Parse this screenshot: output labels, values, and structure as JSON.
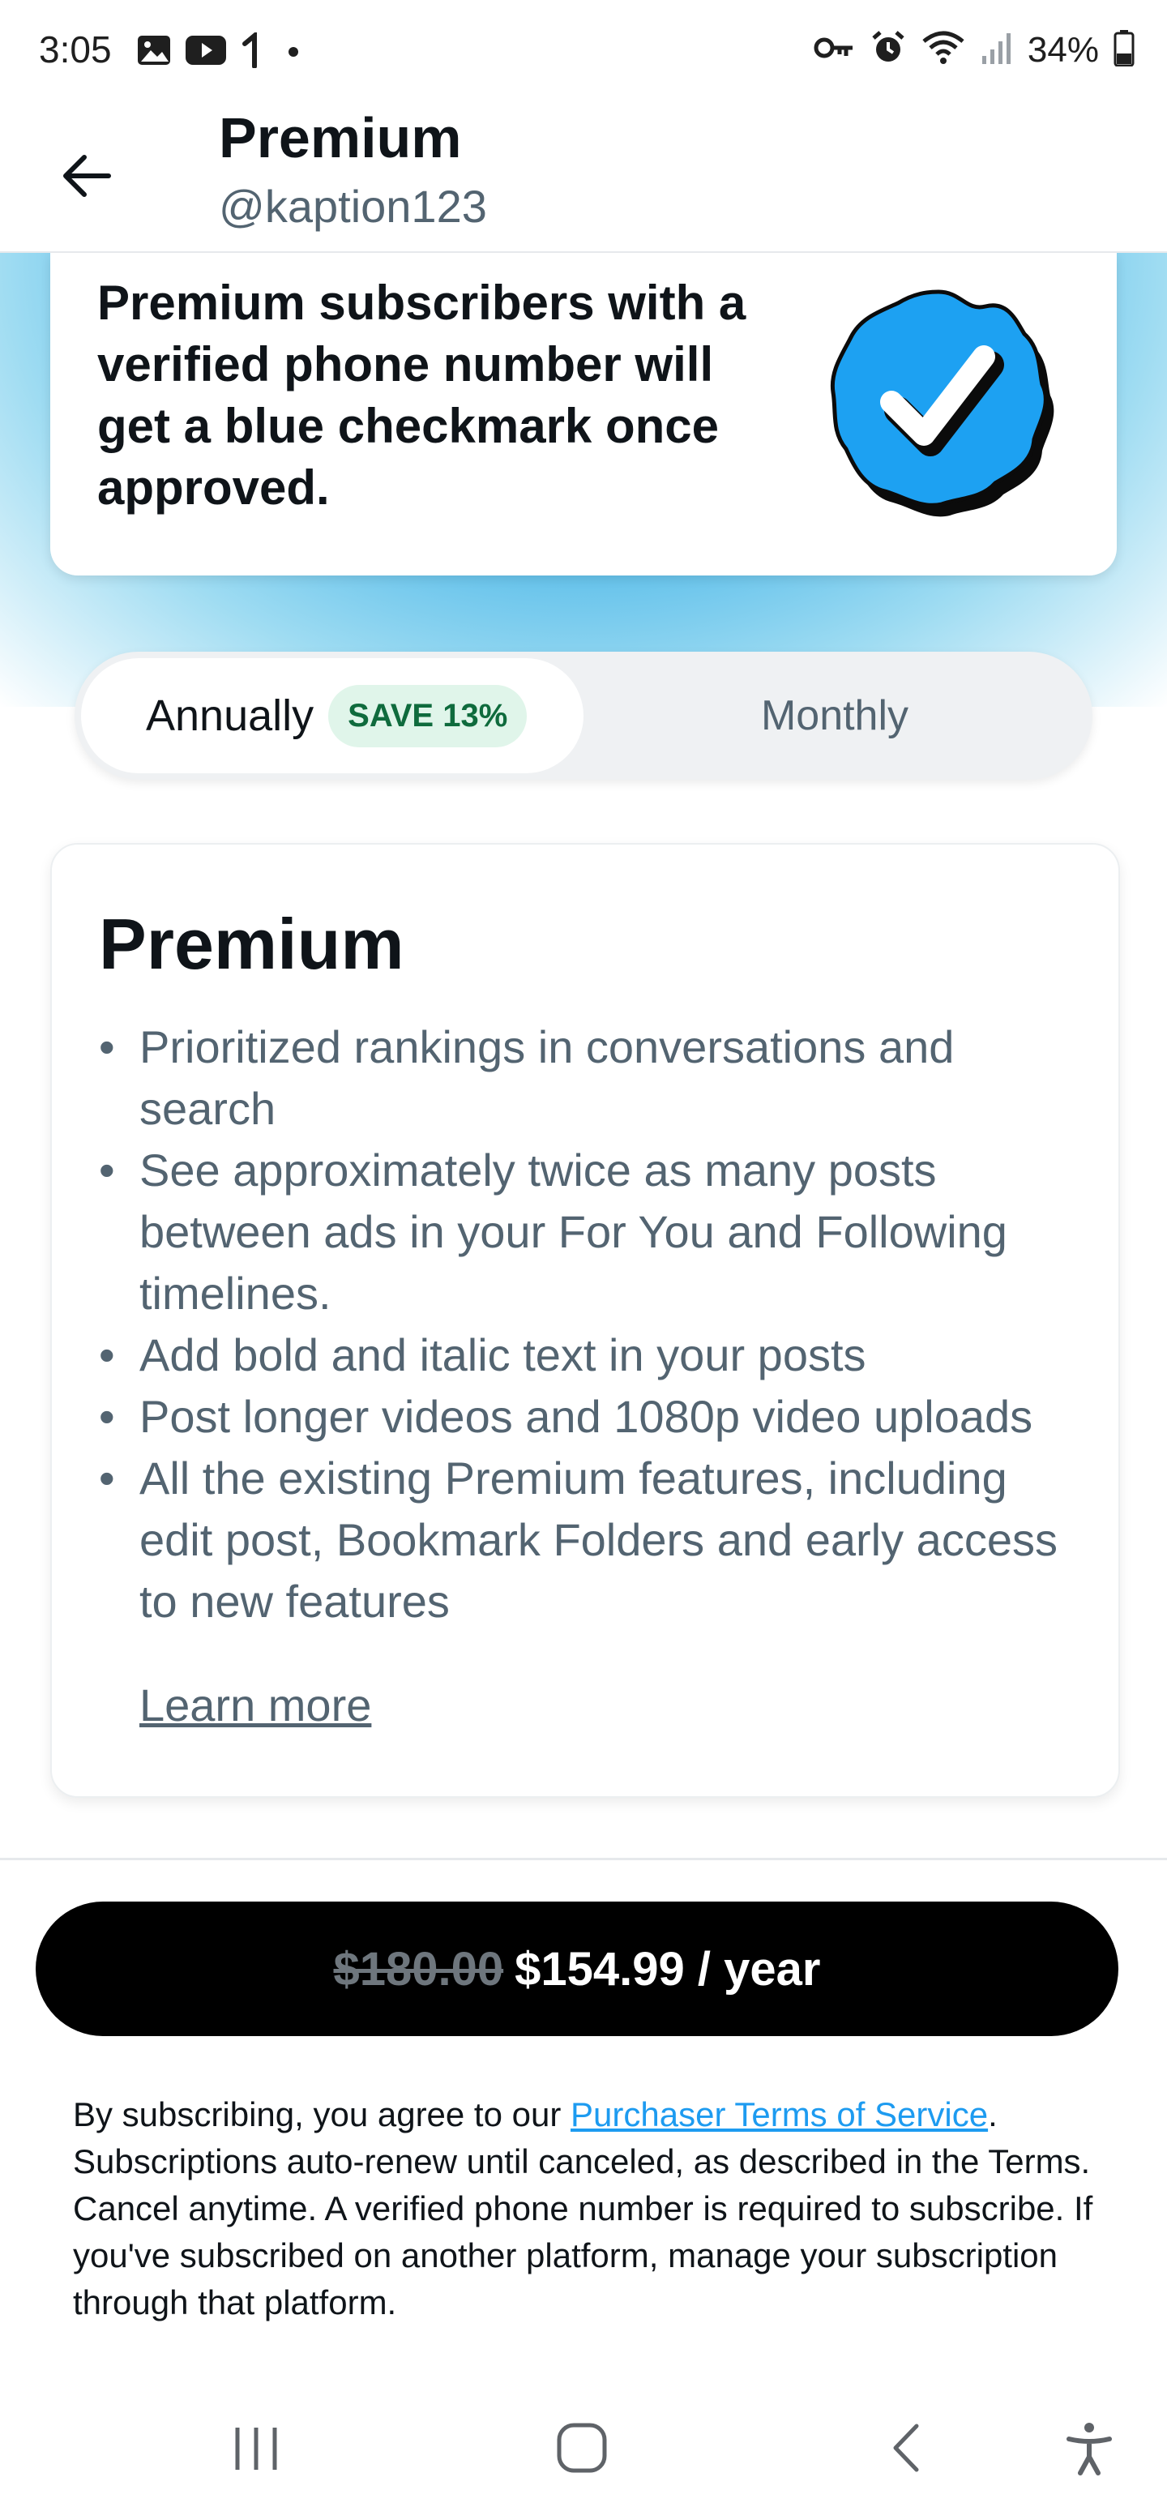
{
  "status_bar": {
    "time": "3:05",
    "battery_text": "34%",
    "left_icons": [
      "gallery-icon",
      "youtube-icon",
      "assist-icon",
      "dot-icon"
    ],
    "right_icons": [
      "key-icon",
      "alarm-icon",
      "wifi-icon",
      "signal-icon",
      "battery-icon"
    ]
  },
  "header": {
    "title": "Premium",
    "subtitle": "@kaption123"
  },
  "hero": {
    "text": "Premium subscribers with a verified phone number will get a blue checkmark once approved."
  },
  "billing_toggle": {
    "annual_label": "Annually",
    "save_badge": "SAVE 13%",
    "monthly_label": "Monthly",
    "selected": "Annually"
  },
  "plan": {
    "title": "Premium",
    "features": [
      "Prioritized rankings in conversations and search",
      "See approximately twice as many posts between ads in your For You and Following timelines.",
      "Add bold and italic text in your posts",
      "Post longer videos and 1080p video uploads",
      "All the existing Premium features, including edit post, Bookmark Folders and early access to new features"
    ],
    "learn_more": "Learn more"
  },
  "subscribe": {
    "old_price": "$180.00",
    "price": "$154.99 / year"
  },
  "legal": {
    "prefix": "By subscribing, you agree to our ",
    "link": "Purchaser Terms of Service",
    "suffix": ". Subscriptions auto-renew until canceled, as described in the Terms. Cancel anytime. A verified phone number is required to subscribe. If you've subscribed on another platform, manage your subscription through that platform."
  },
  "colors": {
    "accent_blue": "#1d9bf0",
    "save_badge_bg": "#e0f5ea",
    "save_badge_text": "#0f6b3d",
    "button_bg": "#000000"
  }
}
